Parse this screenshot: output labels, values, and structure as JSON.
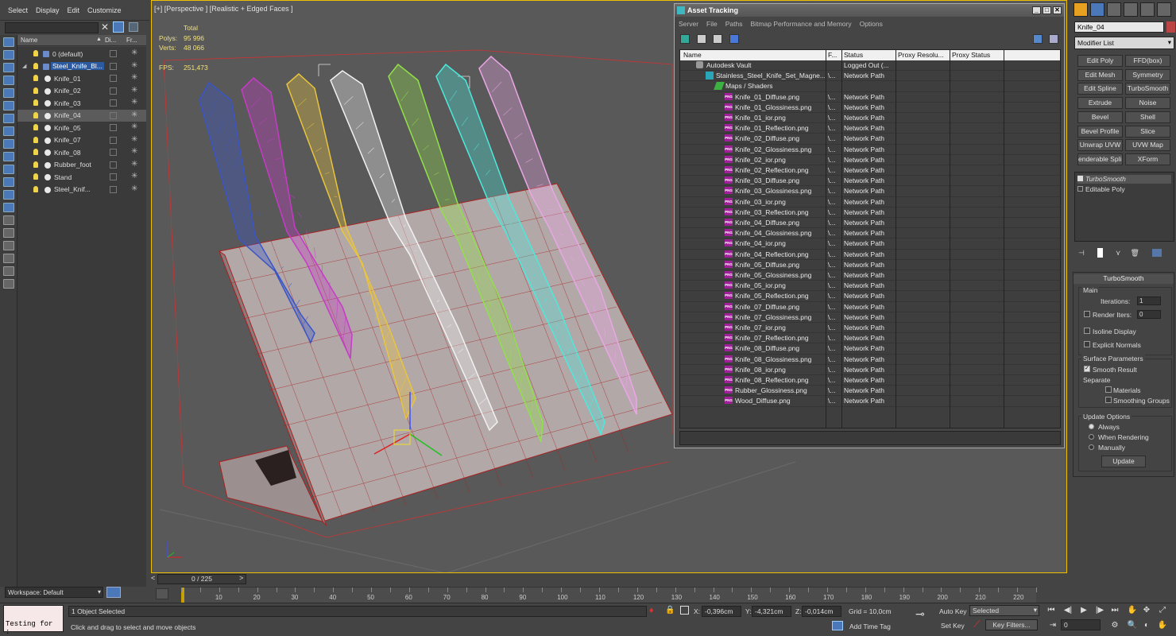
{
  "scene_explorer": {
    "menu": [
      "Select",
      "Display",
      "Edit",
      "Customize"
    ],
    "columns": {
      "name": "Name",
      "display": "Di...",
      "freeze": "Fr..."
    },
    "rows": [
      {
        "name": "0 (default)",
        "depth": 0,
        "type": "layer"
      },
      {
        "name": "Steel_Knife_Bl...",
        "depth": 1,
        "type": "layer",
        "highlight": true
      },
      {
        "name": "Knife_01",
        "depth": 2,
        "type": "object"
      },
      {
        "name": "Knife_02",
        "depth": 2,
        "type": "object"
      },
      {
        "name": "Knife_03",
        "depth": 2,
        "type": "object"
      },
      {
        "name": "Knife_04",
        "depth": 2,
        "type": "object",
        "selected": true
      },
      {
        "name": "Knife_05",
        "depth": 2,
        "type": "object"
      },
      {
        "name": "Knife_07",
        "depth": 2,
        "type": "object"
      },
      {
        "name": "Knife_08",
        "depth": 2,
        "type": "object"
      },
      {
        "name": "Rubber_foot",
        "depth": 2,
        "type": "object"
      },
      {
        "name": "Stand",
        "depth": 2,
        "type": "object"
      },
      {
        "name": "Steel_Knif...",
        "depth": 2,
        "type": "object"
      }
    ],
    "workspace": "Workspace: Default"
  },
  "viewport": {
    "label": "[+] [Perspective ] [Realistic + Edged Faces ]",
    "stats": {
      "total_label": "Total",
      "polys_label": "Polys:",
      "polys": "95 996",
      "verts_label": "Verts:",
      "verts": "48 066",
      "fps_label": "FPS:",
      "fps": "251,473"
    },
    "knife_colors": [
      "#3a55c8",
      "#c63bc6",
      "#e8c440",
      "#f2f2f2",
      "#92e04a",
      "#4ee8dc",
      "#eaa6e6"
    ]
  },
  "asset_tracking": {
    "title": "Asset Tracking",
    "menu": [
      "Server",
      "File",
      "Paths",
      "Bitmap Performance and Memory",
      "Options"
    ],
    "columns": {
      "name": "Name",
      "full": "F...",
      "status": "Status",
      "proxy_res": "Proxy Resolu...",
      "proxy_status": "Proxy Status"
    },
    "rows": [
      {
        "name": "Autodesk Vault",
        "full": "",
        "status": "Logged Out (...",
        "indent": 1,
        "icon": "vault"
      },
      {
        "name": "Stainless_Steel_Knife_Set_Magne...",
        "full": "\\...",
        "status": "Network Path",
        "indent": 2,
        "icon": "max"
      },
      {
        "name": "Maps / Shaders",
        "full": "",
        "status": "",
        "indent": 3,
        "icon": "maps"
      },
      {
        "name": "Knife_01_Diffuse.png",
        "full": "\\...",
        "status": "Network Path",
        "indent": 4,
        "icon": "png"
      },
      {
        "name": "Knife_01_Glossiness.png",
        "full": "\\...",
        "status": "Network Path",
        "indent": 4,
        "icon": "png"
      },
      {
        "name": "Knife_01_ior.png",
        "full": "\\...",
        "status": "Network Path",
        "indent": 4,
        "icon": "png"
      },
      {
        "name": "Knife_01_Reflection.png",
        "full": "\\...",
        "status": "Network Path",
        "indent": 4,
        "icon": "png"
      },
      {
        "name": "Knife_02_Diffuse.png",
        "full": "\\...",
        "status": "Network Path",
        "indent": 4,
        "icon": "png"
      },
      {
        "name": "Knife_02_Glossiness.png",
        "full": "\\...",
        "status": "Network Path",
        "indent": 4,
        "icon": "png"
      },
      {
        "name": "Knife_02_ior.png",
        "full": "\\...",
        "status": "Network Path",
        "indent": 4,
        "icon": "png"
      },
      {
        "name": "Knife_02_Reflection.png",
        "full": "\\...",
        "status": "Network Path",
        "indent": 4,
        "icon": "png"
      },
      {
        "name": "Knife_03_Diffuse.png",
        "full": "\\...",
        "status": "Network Path",
        "indent": 4,
        "icon": "png"
      },
      {
        "name": "Knife_03_Glossiness.png",
        "full": "\\...",
        "status": "Network Path",
        "indent": 4,
        "icon": "png"
      },
      {
        "name": "Knife_03_ior.png",
        "full": "\\...",
        "status": "Network Path",
        "indent": 4,
        "icon": "png"
      },
      {
        "name": "Knife_03_Reflection.png",
        "full": "\\...",
        "status": "Network Path",
        "indent": 4,
        "icon": "png"
      },
      {
        "name": "Knife_04_Diffuse.png",
        "full": "\\...",
        "status": "Network Path",
        "indent": 4,
        "icon": "png"
      },
      {
        "name": "Knife_04_Glossiness.png",
        "full": "\\...",
        "status": "Network Path",
        "indent": 4,
        "icon": "png"
      },
      {
        "name": "Knife_04_ior.png",
        "full": "\\...",
        "status": "Network Path",
        "indent": 4,
        "icon": "png"
      },
      {
        "name": "Knife_04_Reflection.png",
        "full": "\\...",
        "status": "Network Path",
        "indent": 4,
        "icon": "png"
      },
      {
        "name": "Knife_05_Diffuse.png",
        "full": "\\...",
        "status": "Network Path",
        "indent": 4,
        "icon": "png"
      },
      {
        "name": "Knife_05_Glossiness.png",
        "full": "\\...",
        "status": "Network Path",
        "indent": 4,
        "icon": "png"
      },
      {
        "name": "Knife_05_ior.png",
        "full": "\\...",
        "status": "Network Path",
        "indent": 4,
        "icon": "png"
      },
      {
        "name": "Knife_05_Reflection.png",
        "full": "\\...",
        "status": "Network Path",
        "indent": 4,
        "icon": "png"
      },
      {
        "name": "Knife_07_Diffuse.png",
        "full": "\\...",
        "status": "Network Path",
        "indent": 4,
        "icon": "png"
      },
      {
        "name": "Knife_07_Glossiness.png",
        "full": "\\...",
        "status": "Network Path",
        "indent": 4,
        "icon": "png"
      },
      {
        "name": "Knife_07_ior.png",
        "full": "\\...",
        "status": "Network Path",
        "indent": 4,
        "icon": "png"
      },
      {
        "name": "Knife_07_Reflection.png",
        "full": "\\...",
        "status": "Network Path",
        "indent": 4,
        "icon": "png"
      },
      {
        "name": "Knife_08_Diffuse.png",
        "full": "\\...",
        "status": "Network Path",
        "indent": 4,
        "icon": "png"
      },
      {
        "name": "Knife_08_Glossiness.png",
        "full": "\\...",
        "status": "Network Path",
        "indent": 4,
        "icon": "png"
      },
      {
        "name": "Knife_08_ior.png",
        "full": "\\...",
        "status": "Network Path",
        "indent": 4,
        "icon": "png"
      },
      {
        "name": "Knife_08_Reflection.png",
        "full": "\\...",
        "status": "Network Path",
        "indent": 4,
        "icon": "png"
      },
      {
        "name": "Rubber_Glossiness.png",
        "full": "\\...",
        "status": "Network Path",
        "indent": 4,
        "icon": "png"
      },
      {
        "name": "Wood_Diffuse.png",
        "full": "\\...",
        "status": "Network Path",
        "indent": 4,
        "icon": "png"
      }
    ]
  },
  "command_panel": {
    "object_name": "Knife_04",
    "modifier_list": "Modifier List",
    "modifier_buttons": [
      "Edit Poly",
      "FFD(box)",
      "Edit Mesh",
      "Symmetry",
      "Edit Spline",
      "TurboSmooth",
      "Extrude",
      "Noise",
      "Bevel",
      "Shell",
      "Bevel Profile",
      "Slice",
      "Unwrap UVW",
      "UVW Map",
      "enderable Splir",
      "XForm"
    ],
    "stack": [
      "TurboSmooth",
      "Editable Poly"
    ],
    "turbosmooth": {
      "title": "TurboSmooth",
      "main": "Main",
      "iterations_label": "Iterations:",
      "iterations": "1",
      "render_iters_label": "Render Iters:",
      "render_iters": "0",
      "isoline": "Isoline Display",
      "explicit_normals": "Explicit Normals",
      "surface_params": "Surface Parameters",
      "smooth_result": "Smooth Result",
      "separate": "Separate",
      "materials": "Materials",
      "smoothing_groups": "Smoothing Groups",
      "update_options": "Update Options",
      "always": "Always",
      "when_rendering": "When Rendering",
      "manually": "Manually",
      "update_btn": "Update"
    }
  },
  "timeline": {
    "slider": "0 / 225",
    "ticks": [
      "10",
      "20",
      "30",
      "40",
      "50",
      "60",
      "70",
      "80",
      "90",
      "100",
      "110",
      "120",
      "130",
      "140",
      "150",
      "160",
      "170",
      "180",
      "190",
      "200",
      "210",
      "220"
    ]
  },
  "status_bar": {
    "maxscript": "Testing for :",
    "selection": "1 Object Selected",
    "prompt": "Click and drag to select and move objects",
    "x_label": "X:",
    "x": "-0,396cm",
    "y_label": "Y:",
    "y": "-4,321cm",
    "z_label": "Z:",
    "z": "-0,014cm",
    "grid": "Grid = 10,0cm",
    "add_time_tag": "Add Time Tag",
    "auto_key": "Auto Key",
    "selected": "Selected",
    "set_key": "Set Key",
    "key_filters": "Key Filters...",
    "frame": "0"
  }
}
